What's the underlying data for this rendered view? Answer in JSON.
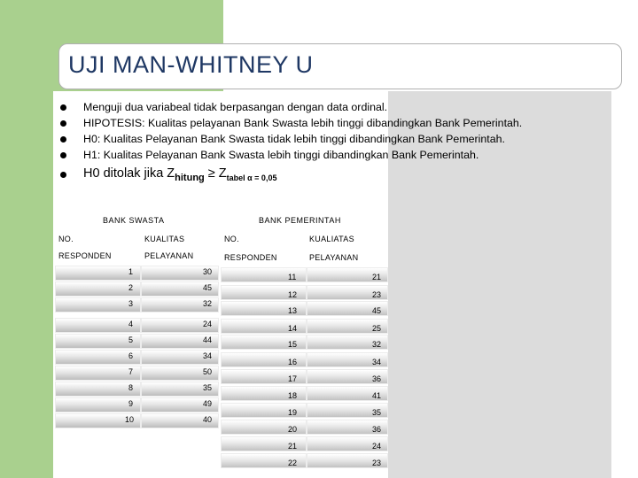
{
  "slide": {
    "title": "UJI MAN-WHITNEY  U",
    "bullets": [
      "Menguji dua variabeal tidak berpasangan dengan data ordinal.",
      "HIPOTESIS:  Kualitas pelayanan Bank Swasta lebih tinggi dibandingkan Bank Pemerintah.",
      "H0:  Kualitas Pelayanan Bank Swasta tidak lebih tinggi dibandingkan Bank Pemerintah.",
      "H1:  Kualitas Pelayanan Bank Swasta lebih tinggi dibandingkan Bank Pemerintah."
    ],
    "rule": {
      "prefix": "H0 ditolak jika Z",
      "sub1": "hitung",
      "operator": " ≥  Z",
      "sub2": "tabel α = 0,05"
    }
  },
  "table": {
    "swasta_caption": "BANK SWASTA",
    "pemerintah_caption": "BANK PEMERINTAH",
    "headers": {
      "no": "NO.",
      "kualitas": "KUALITAS",
      "kualiatas": "KUALIATAS",
      "responden": "RESPONDEN",
      "pelayanan": "PELAYANAN"
    },
    "swasta": [
      {
        "no": "1",
        "value": "30"
      },
      {
        "no": "2",
        "value": "45"
      },
      {
        "no": "3",
        "value": "32"
      },
      {
        "no": "4",
        "value": "24"
      },
      {
        "no": "5",
        "value": "44"
      },
      {
        "no": "6",
        "value": "34"
      },
      {
        "no": "7",
        "value": "50"
      },
      {
        "no": "8",
        "value": "35"
      },
      {
        "no": "9",
        "value": "49"
      },
      {
        "no": "10",
        "value": "40"
      }
    ],
    "pemerintah": [
      {
        "no": "11",
        "value": "21"
      },
      {
        "no": "12",
        "value": "23"
      },
      {
        "no": "13",
        "value": "45"
      },
      {
        "no": "14",
        "value": "25"
      },
      {
        "no": "15",
        "value": "32"
      },
      {
        "no": "16",
        "value": "34"
      },
      {
        "no": "17",
        "value": "36"
      },
      {
        "no": "18",
        "value": "41"
      },
      {
        "no": "19",
        "value": "35"
      },
      {
        "no": "20",
        "value": "36"
      },
      {
        "no": "21",
        "value": "24"
      },
      {
        "no": "22",
        "value": "23"
      }
    ]
  }
}
